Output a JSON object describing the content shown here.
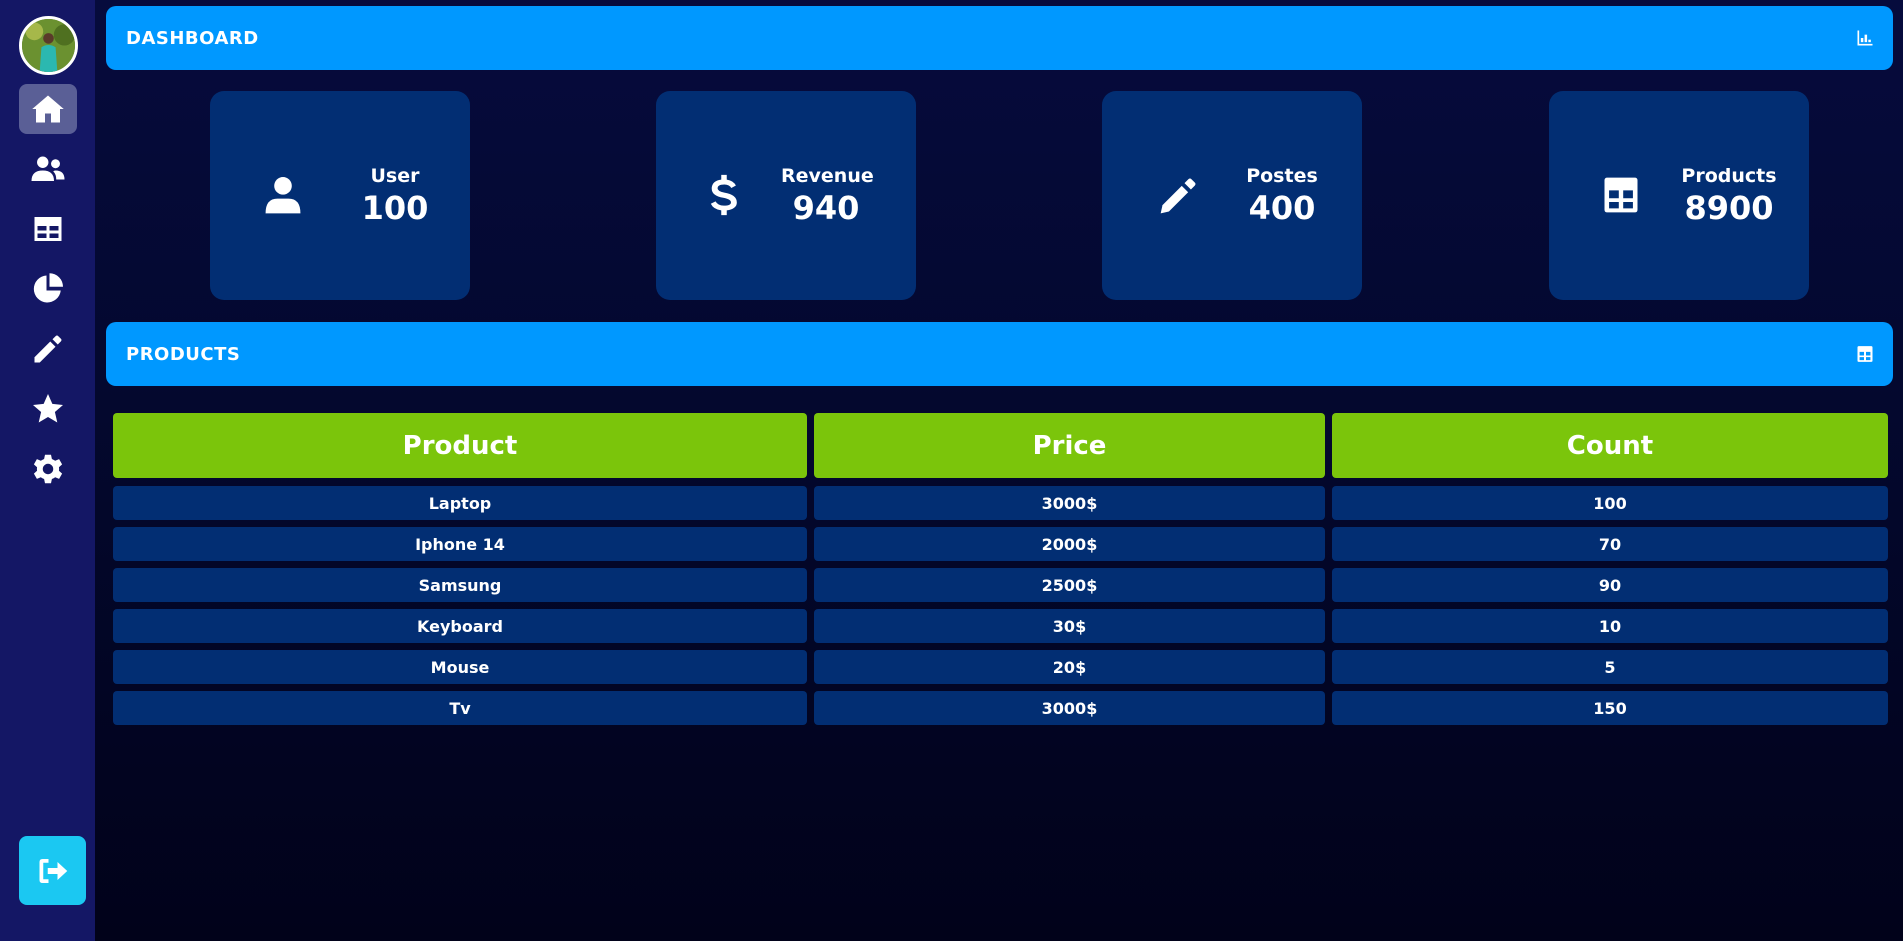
{
  "sidebar": {
    "nav": [
      {
        "icon": "home-icon",
        "active": true
      },
      {
        "icon": "users-icon",
        "active": false
      },
      {
        "icon": "table-icon",
        "active": false
      },
      {
        "icon": "pie-chart-icon",
        "active": false
      },
      {
        "icon": "pencil-icon",
        "active": false
      },
      {
        "icon": "star-icon",
        "active": false
      },
      {
        "icon": "gear-icon",
        "active": false
      }
    ],
    "logout_icon": "logout-icon"
  },
  "dashboard": {
    "title": "DASHBOARD",
    "icon": "bar-chart-icon"
  },
  "cards": [
    {
      "label": "User",
      "value": "100",
      "icon": "user-icon"
    },
    {
      "label": "Revenue",
      "value": "940",
      "icon": "dollar-icon"
    },
    {
      "label": "Postes",
      "value": "400",
      "icon": "pencil-icon"
    },
    {
      "label": "Products",
      "value": "8900",
      "icon": "table-icon"
    }
  ],
  "products": {
    "title": "PRODUCTS",
    "icon": "table-icon",
    "columns": [
      "Product",
      "Price",
      "Count"
    ],
    "rows": [
      [
        "Laptop",
        "3000$",
        "100"
      ],
      [
        "Iphone 14",
        "2000$",
        "70"
      ],
      [
        "Samsung",
        "2500$",
        "90"
      ],
      [
        "Keyboard",
        "30$",
        "10"
      ],
      [
        "Mouse",
        "20$",
        "5"
      ],
      [
        "Tv",
        "3000$",
        "150"
      ]
    ]
  },
  "colors": {
    "sidebar": "#141765",
    "header": "#0098ff",
    "card": "#022e73",
    "table_header": "#7bc50b",
    "logout": "#1bc8f2",
    "active_nav": "#5a5f96"
  }
}
